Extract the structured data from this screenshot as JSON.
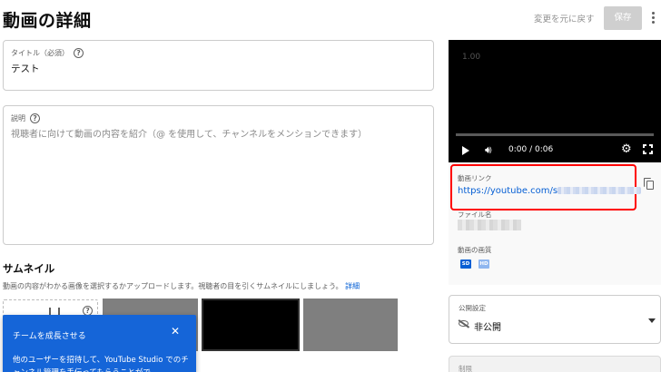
{
  "header": {
    "title": "動画の詳細",
    "undo_label": "変更を元に戻す",
    "save_label": "保存"
  },
  "title_field": {
    "label": "タイトル（必須）",
    "value": "テスト"
  },
  "description_field": {
    "label": "説明",
    "placeholder": "視聴者に向けて動画の内容を紹介（@ を使用して、チャンネルをメンションできます）"
  },
  "thumbnail": {
    "heading": "サムネイル",
    "description": "動画の内容がわかる画像を選択するかアップロードします。視聴者の目を引くサムネイルにしましょう。",
    "link": "詳細"
  },
  "popup": {
    "title": "チームを成長させる",
    "close": "✕",
    "body": "他のユーザーを招待して、YouTube Studio でのチャンネル管理を手伝ってもらうことがで"
  },
  "player": {
    "counter": "1.00",
    "time": "0:00 / 0:06",
    "progress_fraction": 0
  },
  "video_link": {
    "label": "動画リンク",
    "value": "https://youtube.com/s"
  },
  "filename": {
    "label": "ファイル名"
  },
  "quality": {
    "label": "動画の画質",
    "badges": [
      "SD",
      "HD"
    ]
  },
  "visibility": {
    "label": "公開設定",
    "value": "非公開"
  },
  "restrictions": {
    "label": "制限"
  },
  "colors": {
    "accent": "#065fd4",
    "popup_bg": "#1565d8",
    "highlight": "#ff0000"
  }
}
